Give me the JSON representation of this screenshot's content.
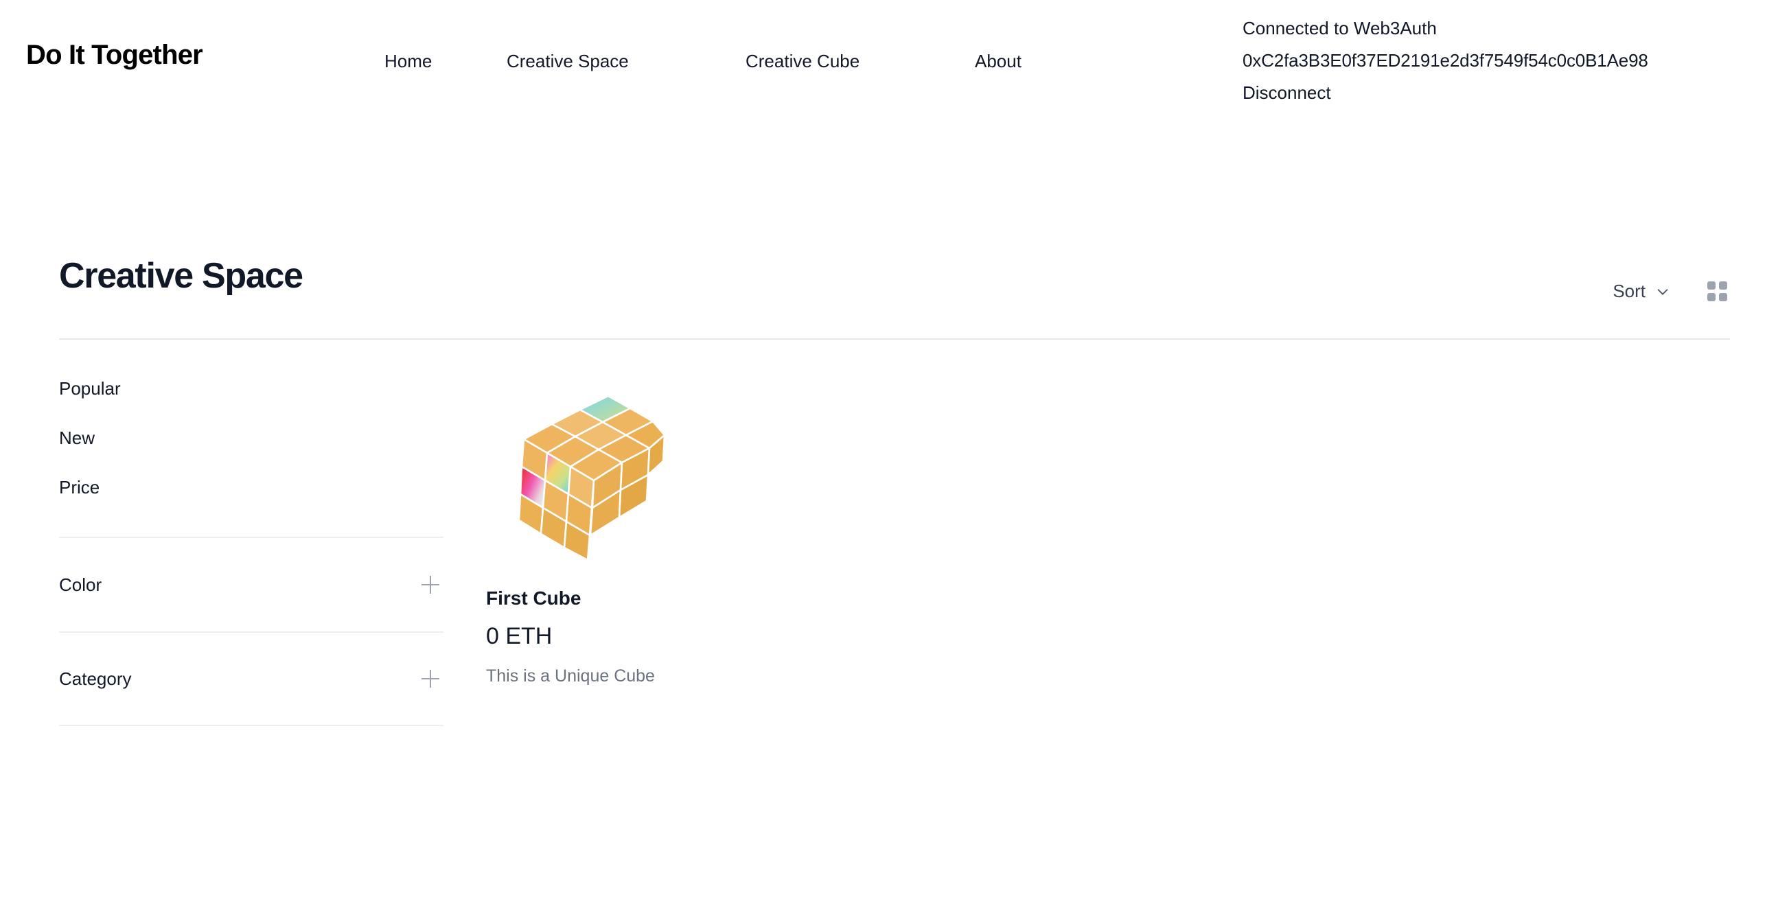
{
  "header": {
    "brand": "Do It Together",
    "nav": [
      {
        "label": "Home"
      },
      {
        "label": "Creative Space"
      },
      {
        "label": "Creative Cube"
      },
      {
        "label": "About"
      }
    ],
    "wallet": {
      "status": "Connected to Web3Auth",
      "address": "0xC2fa3B3E0f37ED2191e2d3f7549f54c0c0B1Ae98",
      "disconnect_label": "Disconnect"
    }
  },
  "page": {
    "title": "Creative Space",
    "sort_label": "Sort",
    "sort_icon": "chevron-down-icon",
    "grid_view_icon": "grid-view-icon"
  },
  "filters": {
    "links": [
      {
        "label": "Popular"
      },
      {
        "label": "New"
      },
      {
        "label": "Price"
      }
    ],
    "sections": [
      {
        "label": "Color",
        "icon": "plus-icon"
      },
      {
        "label": "Category",
        "icon": "plus-icon"
      }
    ]
  },
  "products": [
    {
      "name": "First Cube",
      "price": "0 ETH",
      "description": "This is a Unique Cube"
    }
  ],
  "colors": {
    "text_primary": "#111827",
    "text_muted": "#6b7280",
    "divider": "#e5e7eb",
    "icon_gray": "#9ca3af",
    "cube_tan": "#eeb45e",
    "cube_tan_light": "#f0bd71",
    "cube_tan_dark": "#e5a948"
  }
}
